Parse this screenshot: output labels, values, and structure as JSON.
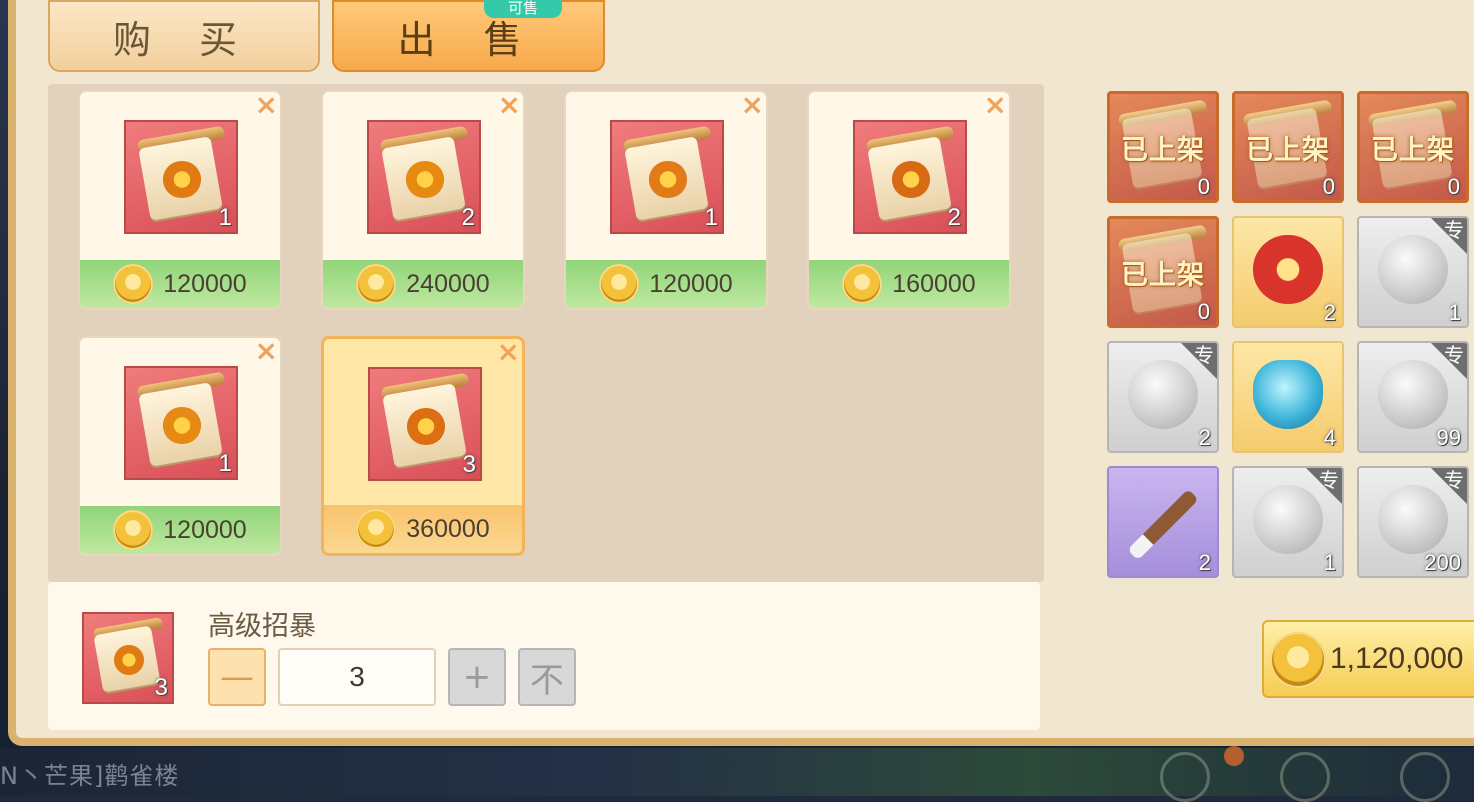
{
  "tabs": {
    "buy": "购 买",
    "sell": "出 售",
    "sell_badge": "可售"
  },
  "listings": [
    {
      "price": "120000",
      "qty": "1",
      "emblem": "#e07a12"
    },
    {
      "price": "240000",
      "qty": "2",
      "emblem": "#e88a10"
    },
    {
      "price": "120000",
      "qty": "1",
      "emblem": "#e37a18"
    },
    {
      "price": "160000",
      "qty": "2",
      "emblem": "#d96a14"
    },
    {
      "price": "120000",
      "qty": "1",
      "emblem": "#e68a14"
    },
    {
      "price": "360000",
      "qty": "3",
      "emblem": "#dc6f12",
      "selected": true
    }
  ],
  "detail": {
    "item_name": "高级招暴",
    "qty_badge": "3",
    "quantity_value": "3",
    "minus_label": "—",
    "plus_label": "+",
    "max_label": "不"
  },
  "inventory": {
    "listed_label": "已上架",
    "exclusive_label": "专",
    "slots": [
      {
        "type": "listed",
        "qty": "0"
      },
      {
        "type": "listed",
        "qty": "0"
      },
      {
        "type": "listed",
        "qty": "0"
      },
      {
        "type": "listed",
        "qty": "0"
      },
      {
        "type": "gold-red-orb",
        "qty": "2"
      },
      {
        "type": "gray-crystal",
        "qty": "1",
        "exclusive": true
      },
      {
        "type": "gray-vase",
        "qty": "2",
        "exclusive": true
      },
      {
        "type": "gold-blue-vase",
        "qty": "4"
      },
      {
        "type": "gray-orb",
        "qty": "99",
        "exclusive": true
      },
      {
        "type": "purple-brush",
        "qty": "2"
      },
      {
        "type": "gray-scroll",
        "qty": "1",
        "exclusive": true
      },
      {
        "type": "gray-pearl",
        "qty": "200",
        "exclusive": true
      }
    ]
  },
  "total": {
    "amount": "1,120,000"
  },
  "background": {
    "chat_text": "N丶芒果]鹳雀楼"
  }
}
